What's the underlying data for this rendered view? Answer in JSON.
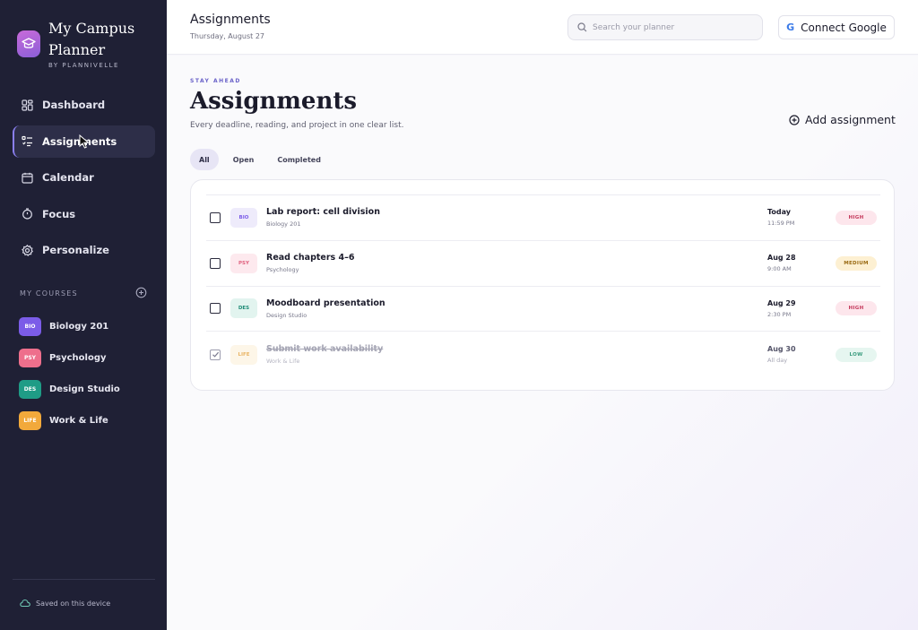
{
  "sidebar": {
    "brand_title": "My Campus Planner",
    "brand_subtitle": "BY PLANNIVELLE",
    "nav": [
      {
        "label": "Dashboard",
        "icon": "dashboard-icon"
      },
      {
        "label": "Assignments",
        "icon": "list-icon",
        "active": true
      },
      {
        "label": "Calendar",
        "icon": "calendar-icon"
      },
      {
        "label": "Focus",
        "icon": "timer-icon"
      },
      {
        "label": "Personalize",
        "icon": "gear-icon"
      }
    ],
    "courses_heading": "MY COURSES",
    "courses": [
      {
        "code": "BIO",
        "name": "Biology 201",
        "color": "#7b5ce8"
      },
      {
        "code": "PSY",
        "name": "Psychology",
        "color": "#ee6f8c"
      },
      {
        "code": "DES",
        "name": "Design Studio",
        "color": "#1f9c86"
      },
      {
        "code": "LIFE",
        "name": "Work & Life",
        "color": "#f2a93b"
      }
    ],
    "saved_text": "Saved on this device"
  },
  "topbar": {
    "title": "Assignments",
    "date": "Thursday, August 27",
    "search_placeholder": "Search your planner",
    "search_value": "",
    "connect_label": "Connect Google",
    "connect_glyph": "G"
  },
  "main": {
    "eyebrow": "STAY AHEAD",
    "title": "Assignments",
    "subtitle": "Every deadline, reading, and project in one clear list.",
    "add_label": "Add assignment",
    "tabs": [
      {
        "label": "All",
        "active": true
      },
      {
        "label": "Open"
      },
      {
        "label": "Completed"
      }
    ],
    "assignments": [
      {
        "tag": "BIO",
        "tag_bg": "#eeebfb",
        "tag_color": "#7b5ce8",
        "title": "Lab report: cell division",
        "course": "Biology 201",
        "due_date": "Today",
        "due_time": "11:59 PM",
        "priority": "HIGH",
        "prio_bg": "#fde6ec",
        "prio_color": "#c4395c",
        "done": false
      },
      {
        "tag": "PSY",
        "tag_bg": "#fde9ee",
        "tag_color": "#e0617f",
        "title": "Read chapters 4–6",
        "course": "Psychology",
        "due_date": "Aug 28",
        "due_time": "9:00 AM",
        "priority": "MEDIUM",
        "prio_bg": "#fdf0d2",
        "prio_color": "#9a6a12",
        "done": false
      },
      {
        "tag": "DES",
        "tag_bg": "#e2f4ef",
        "tag_color": "#1f8c77",
        "title": "Moodboard presentation",
        "course": "Design Studio",
        "due_date": "Aug 29",
        "due_time": "2:30 PM",
        "priority": "HIGH",
        "prio_bg": "#fde6ec",
        "prio_color": "#c4395c",
        "done": false
      },
      {
        "tag": "LIFE",
        "tag_bg": "#fdf6e8",
        "tag_color": "#e9b565",
        "title": "Submit work availability",
        "course": "Work & Life",
        "due_date": "Aug 30",
        "due_time": "All day",
        "priority": "LOW",
        "prio_bg": "#e6f6f0",
        "prio_color": "#3a9c7e",
        "done": true
      }
    ]
  }
}
